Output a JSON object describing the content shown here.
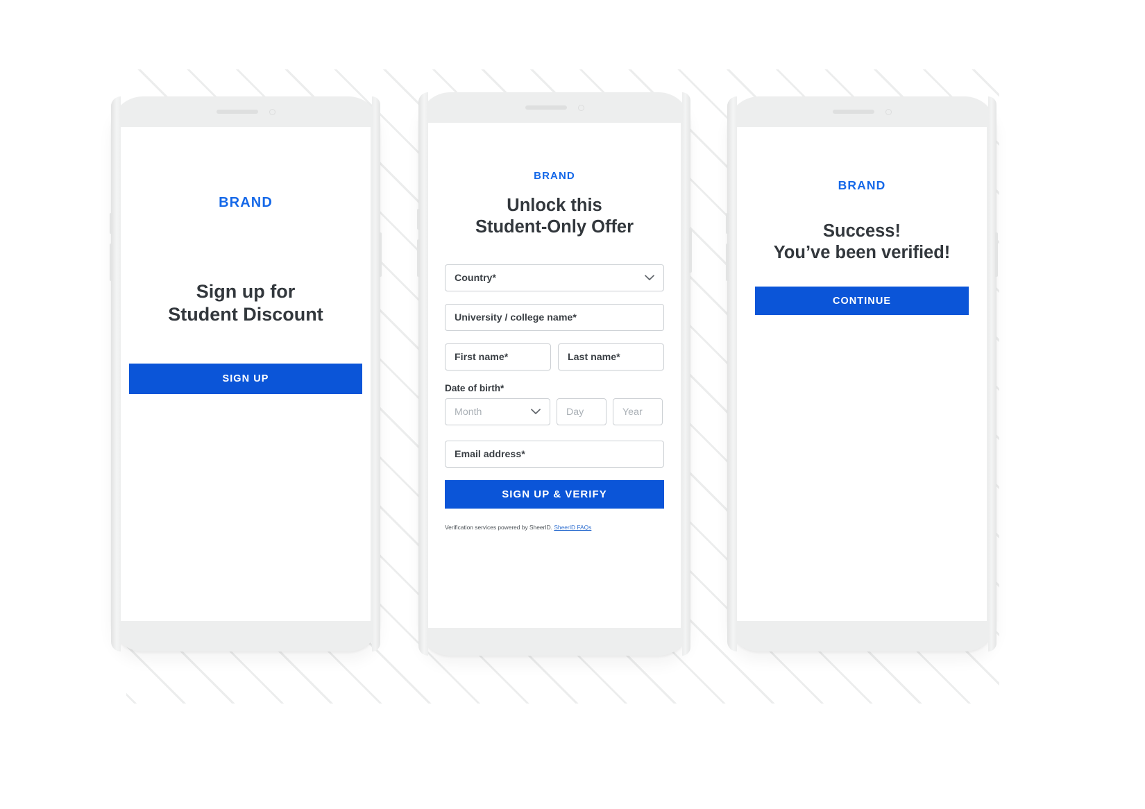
{
  "colors": {
    "brand_blue": "#1568e8",
    "button_blue": "#0b55d8",
    "headline_text": "#32373c",
    "field_border": "#ccd0d4",
    "placeholder_text": "#aab0b6",
    "phone_body": "#edeeee",
    "background": "#ffffff",
    "stripe": "#eceded",
    "link_blue": "#2f6fd0"
  },
  "screens": [
    {
      "id": "signup-landing",
      "brand": "BRAND",
      "headline_line1": "Sign up for",
      "headline_line2": "Student Discount",
      "cta_label": "SIGN UP"
    },
    {
      "id": "verification-form",
      "brand": "BRAND",
      "headline_line1": "Unlock this",
      "headline_line2": "Student-Only Offer",
      "fields": {
        "country": {
          "label": "Country*",
          "value": "Country*",
          "type": "select",
          "icon": "chevron-down-icon"
        },
        "university": {
          "label": "University / college name*",
          "value": "University / college name*",
          "type": "text"
        },
        "first_name": {
          "label": "First name*",
          "value": "First name*",
          "type": "text"
        },
        "last_name": {
          "label": "Last name*",
          "value": "Last name*",
          "type": "text"
        },
        "dob_label": "Date of birth*",
        "dob_month": {
          "placeholder": "Month",
          "type": "select",
          "icon": "chevron-down-icon"
        },
        "dob_day": {
          "placeholder": "Day",
          "type": "text"
        },
        "dob_year": {
          "placeholder": "Year",
          "type": "text"
        },
        "email": {
          "label": "Email address*",
          "value": "Email address*",
          "type": "text"
        }
      },
      "cta_label": "SIGN UP & VERIFY",
      "footer_text": "Verification services powered by SheerID.",
      "footer_link": "SheerID FAQs"
    },
    {
      "id": "success",
      "brand": "BRAND",
      "headline_line1": "Success!",
      "headline_line2": "You’ve been verified!",
      "cta_label": "CONTINUE"
    }
  ]
}
